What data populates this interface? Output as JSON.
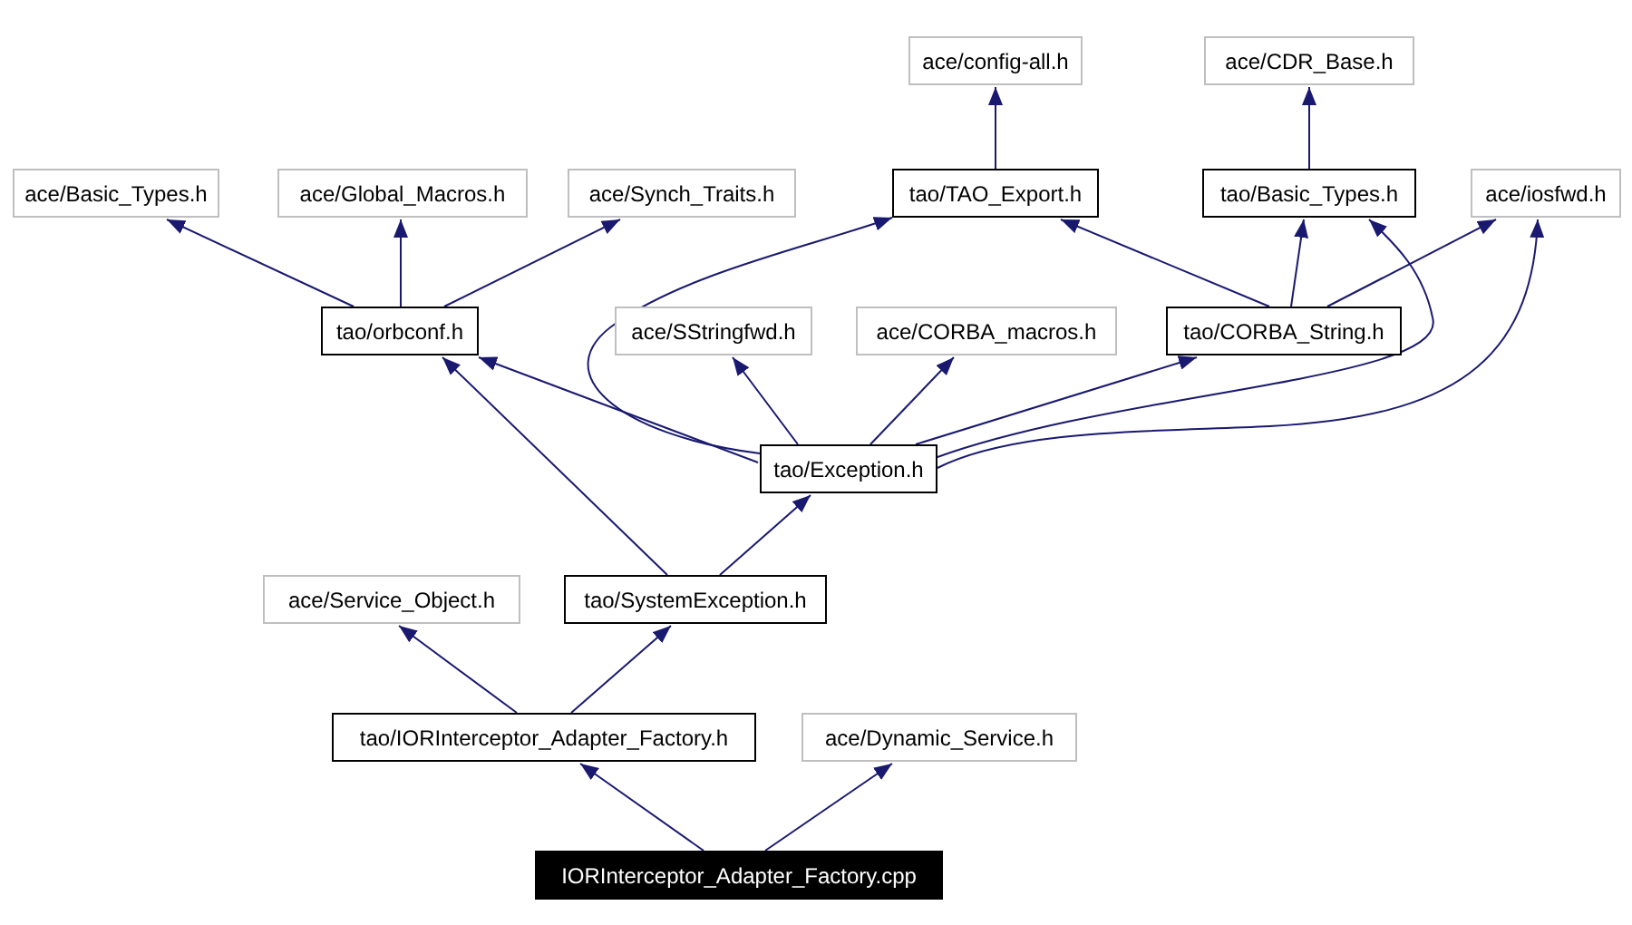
{
  "graph": {
    "nodes": [
      {
        "label": "ace/config-all.h",
        "kind": "external"
      },
      {
        "label": "ace/CDR_Base.h",
        "kind": "external"
      },
      {
        "label": "ace/Basic_Types.h",
        "kind": "external"
      },
      {
        "label": "ace/Global_Macros.h",
        "kind": "external"
      },
      {
        "label": "ace/Synch_Traits.h",
        "kind": "external"
      },
      {
        "label": "tao/TAO_Export.h",
        "kind": "documented"
      },
      {
        "label": "tao/Basic_Types.h",
        "kind": "documented"
      },
      {
        "label": "ace/iosfwd.h",
        "kind": "external"
      },
      {
        "label": "tao/orbconf.h",
        "kind": "documented"
      },
      {
        "label": "ace/SStringfwd.h",
        "kind": "external"
      },
      {
        "label": "ace/CORBA_macros.h",
        "kind": "external"
      },
      {
        "label": "tao/CORBA_String.h",
        "kind": "documented"
      },
      {
        "label": "tao/Exception.h",
        "kind": "documented"
      },
      {
        "label": "ace/Service_Object.h",
        "kind": "external"
      },
      {
        "label": "tao/SystemException.h",
        "kind": "documented"
      },
      {
        "label": "tao/IORInterceptor_Adapter_Factory.h",
        "kind": "documented"
      },
      {
        "label": "ace/Dynamic_Service.h",
        "kind": "external"
      },
      {
        "label": "IORInterceptor_Adapter_Factory.cpp",
        "kind": "root"
      }
    ]
  }
}
